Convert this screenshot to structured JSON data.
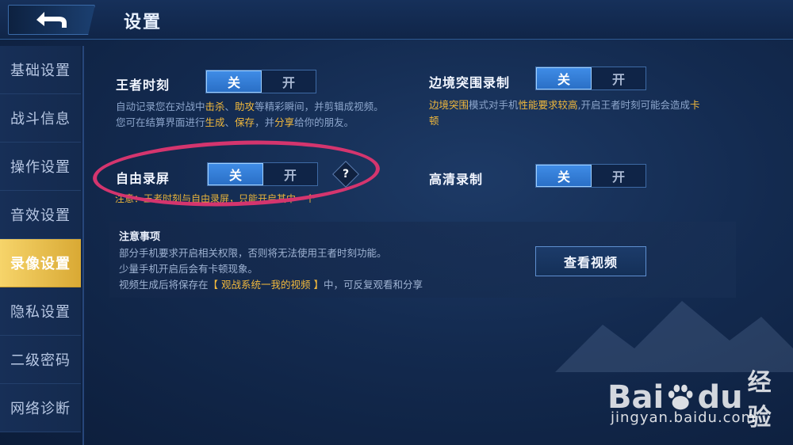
{
  "header": {
    "title": "设置"
  },
  "sidebar": {
    "items": [
      {
        "label": "基础设置",
        "active": false
      },
      {
        "label": "战斗信息",
        "active": false
      },
      {
        "label": "操作设置",
        "active": false
      },
      {
        "label": "音效设置",
        "active": false
      },
      {
        "label": "录像设置",
        "active": true
      },
      {
        "label": "隐私设置",
        "active": false
      },
      {
        "label": "二级密码",
        "active": false
      },
      {
        "label": "网络诊断",
        "active": false
      }
    ]
  },
  "settings": {
    "wangzhe": {
      "label": "王者时刻",
      "off": "关",
      "on": "开",
      "selected": "关",
      "desc_line1_parts": [
        "自动记录您在对战中",
        "击杀",
        "、",
        "助攻",
        "等精彩瞬间，并剪辑成视频。"
      ],
      "desc_line2_parts": [
        "您可在结算界面进行",
        "生成",
        "、",
        "保存",
        "，并",
        "分享",
        "给你的朋友。"
      ]
    },
    "border": {
      "label": "边境突围录制",
      "off": "关",
      "on": "开",
      "selected": "关",
      "desc_line1_parts": [
        "边境突围",
        "模式对手机",
        "性能要求较高",
        ",开启王者时刻可能会造成",
        "卡"
      ],
      "desc_line2": "顿"
    },
    "free": {
      "label": "自由录屏",
      "off": "关",
      "on": "开",
      "selected": "关",
      "help": "?",
      "notice": "注意：王者时刻与自由录屏，只能开启其中一个"
    },
    "hd": {
      "label": "高清录制",
      "off": "关",
      "on": "开",
      "selected": "关"
    }
  },
  "notes": {
    "title": "注意事项",
    "line1": "部分手机要求开启相关权限，否则将无法使用王者时刻功能。",
    "line2": "少量手机开启后会有卡顿现象。",
    "line3_parts": [
      "视频生成后将保存在",
      "【 观战系统一我的视频 】",
      "中，可反复观看和分享"
    ],
    "view_button": "查看视频"
  },
  "watermark": {
    "logo_left": "Bai",
    "logo_right": "du",
    "logo_cn": "经验",
    "url": "jingyan.baidu.com"
  },
  "colors": {
    "accent_active": "#e8bd4a",
    "toggle_on": "#2f7ad6",
    "highlight_text": "#f2b93c",
    "annotation_circle": "#d4356e"
  }
}
